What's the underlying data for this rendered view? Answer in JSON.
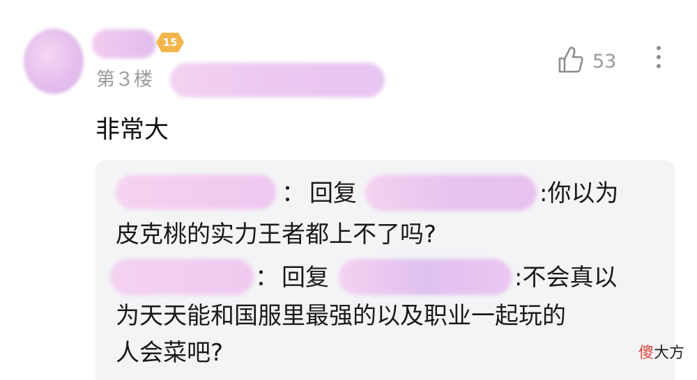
{
  "post": {
    "level_badge": "15",
    "floor_label": "第３楼",
    "like_count": "53",
    "content": "非常大"
  },
  "replies": [
    {
      "separator": "：",
      "reply_word": "回复",
      "line1_tail": ":你以为",
      "line2": "皮克桃的实力王者都上不了吗?"
    },
    {
      "separator": "：",
      "reply_word": "回复",
      "line1_tail": ":不会真以",
      "line2": "为天天能和国服里最强的以及职业一起玩的",
      "line3": "人会菜吧?"
    }
  ],
  "watermark": {
    "accent_char": "傻",
    "rest": "大方"
  },
  "icons": [
    "like-icon",
    "more-icon"
  ],
  "colors": {
    "text": "#1a1a1a",
    "muted": "#9a9a9a",
    "badge": "#f2b64a",
    "reply_bg": "#f4f4f6",
    "watermark_accent": "#e0453b"
  }
}
